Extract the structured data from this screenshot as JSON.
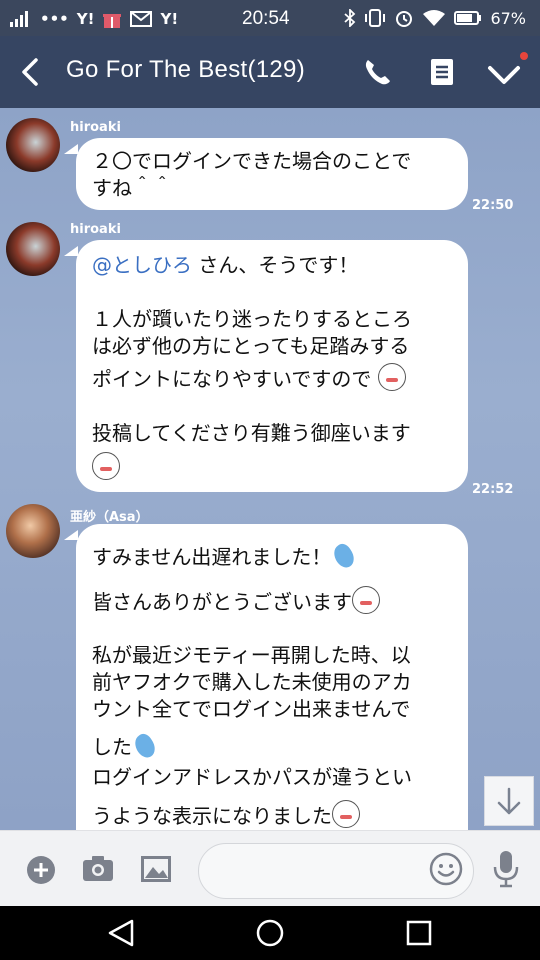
{
  "status_bar": {
    "left_icons": [
      "signal-icon",
      "more-dots-icon",
      "yahoo-icon",
      "gift-icon",
      "mail-icon",
      "yahoo-icon"
    ],
    "time": "20:54",
    "right_icons": [
      "bluetooth-icon",
      "vibrate-icon",
      "alarm-icon",
      "wifi-icon",
      "battery-icon"
    ],
    "battery": "67%"
  },
  "header": {
    "title": "Go For The Best(129)",
    "icons": [
      "back-icon",
      "phone-icon",
      "notes-icon",
      "chevron-down-icon"
    ],
    "colors": {
      "bar": "#364562",
      "status": "#3b475d"
    }
  },
  "messages": [
    {
      "sender": "hiroaki",
      "lines": [
        "２〇でログインできた場合のことで",
        "すね＾＾"
      ],
      "time": "22:50"
    },
    {
      "sender": "hiroaki",
      "mention": "@としひろ",
      "lines": [
        " さん、そうです！",
        "１人が躓いたり迷ったりするところ",
        "は必ず他の方にとっても足踏みする",
        "ポイントになりやすいですので",
        "投稿してくださり有難う御座います"
      ],
      "time": "22:52"
    },
    {
      "sender": "亜紗（Asa）",
      "lines": [
        "すみません出遅れました！",
        "皆さんありがとうございます",
        "私が最近ジモティー再開した時、以",
        "前ヤフオクで購入した未使用のアカ",
        "ウント全てでログイン出来ませんで",
        "した",
        "ログインアドレスかパスが違うとい",
        "うような表示になりました"
      ]
    }
  ],
  "input_bar": {
    "icons": [
      "plus-icon",
      "camera-icon",
      "image-icon",
      "smile-icon",
      "mic-icon"
    ]
  },
  "nav_bar": {
    "icons": [
      "nav-back-icon",
      "nav-home-icon",
      "nav-recent-icon"
    ]
  }
}
